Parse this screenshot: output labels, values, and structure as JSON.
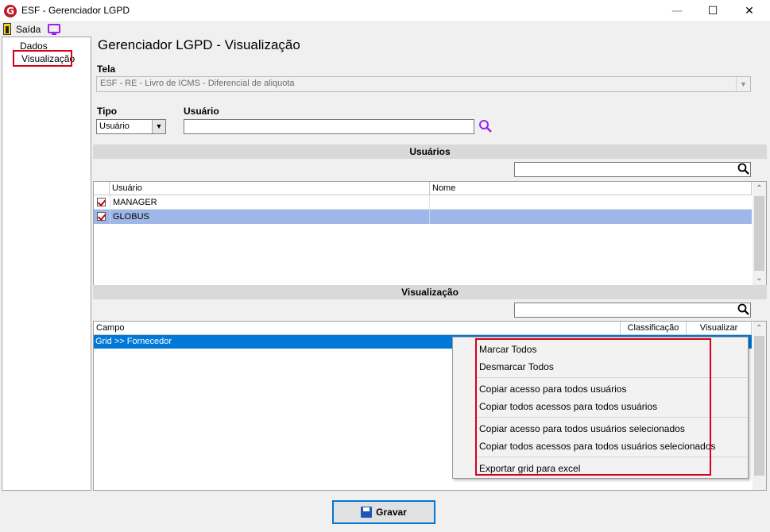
{
  "window": {
    "title": "ESF - Gerenciador LGPD",
    "logo_letter": "G",
    "minimize_glyph": "—",
    "maximize_glyph": "☐",
    "close_glyph": "✕"
  },
  "menu": {
    "exit_label": "Saída",
    "icons": [
      "exit-door-icon",
      "monitor-icon"
    ]
  },
  "tree": {
    "items": [
      {
        "label": "Dados",
        "selected": false
      },
      {
        "label": "Visualização",
        "selected": true
      }
    ]
  },
  "page": {
    "title": "Gerenciador LGPD - Visualização"
  },
  "form": {
    "tela_label": "Tela",
    "tela_value": "ESF - RE - Livro de ICMS - Diferencial de aliquota",
    "tipo_label": "Tipo",
    "tipo_value": "Usuário",
    "usuario_label": "Usuário",
    "usuario_value": ""
  },
  "users_section": {
    "title": "Usuários",
    "search_value": "",
    "columns": [
      "Usuário",
      "Nome"
    ],
    "rows": [
      {
        "checked": true,
        "usuario": "MANAGER",
        "nome": "",
        "selected": false
      },
      {
        "checked": true,
        "usuario": "GLOBUS",
        "nome": "",
        "selected": true
      }
    ]
  },
  "view_section": {
    "title": "Visualização",
    "search_value": "",
    "columns": [
      "Campo",
      "Classificação",
      "Visualizar"
    ],
    "rows": [
      {
        "campo": "Grid >> Fornecedor",
        "selected": true
      }
    ]
  },
  "context_menu": {
    "groups": [
      [
        "Marcar Todos",
        "Desmarcar Todos"
      ],
      [
        "Copiar acesso para todos usuários",
        "Copiar todos acessos para todos usuários"
      ],
      [
        "Copiar acesso para todos usuários selecionados",
        "Copiar todos acessos para todos usuários selecionados"
      ],
      [
        "Exportar grid para excel"
      ]
    ]
  },
  "footer": {
    "save_label": "Gravar"
  },
  "colors": {
    "selection_row": "#9db7e8",
    "selection_row_blue": "#0078d7",
    "highlight_border": "#d7001c"
  }
}
